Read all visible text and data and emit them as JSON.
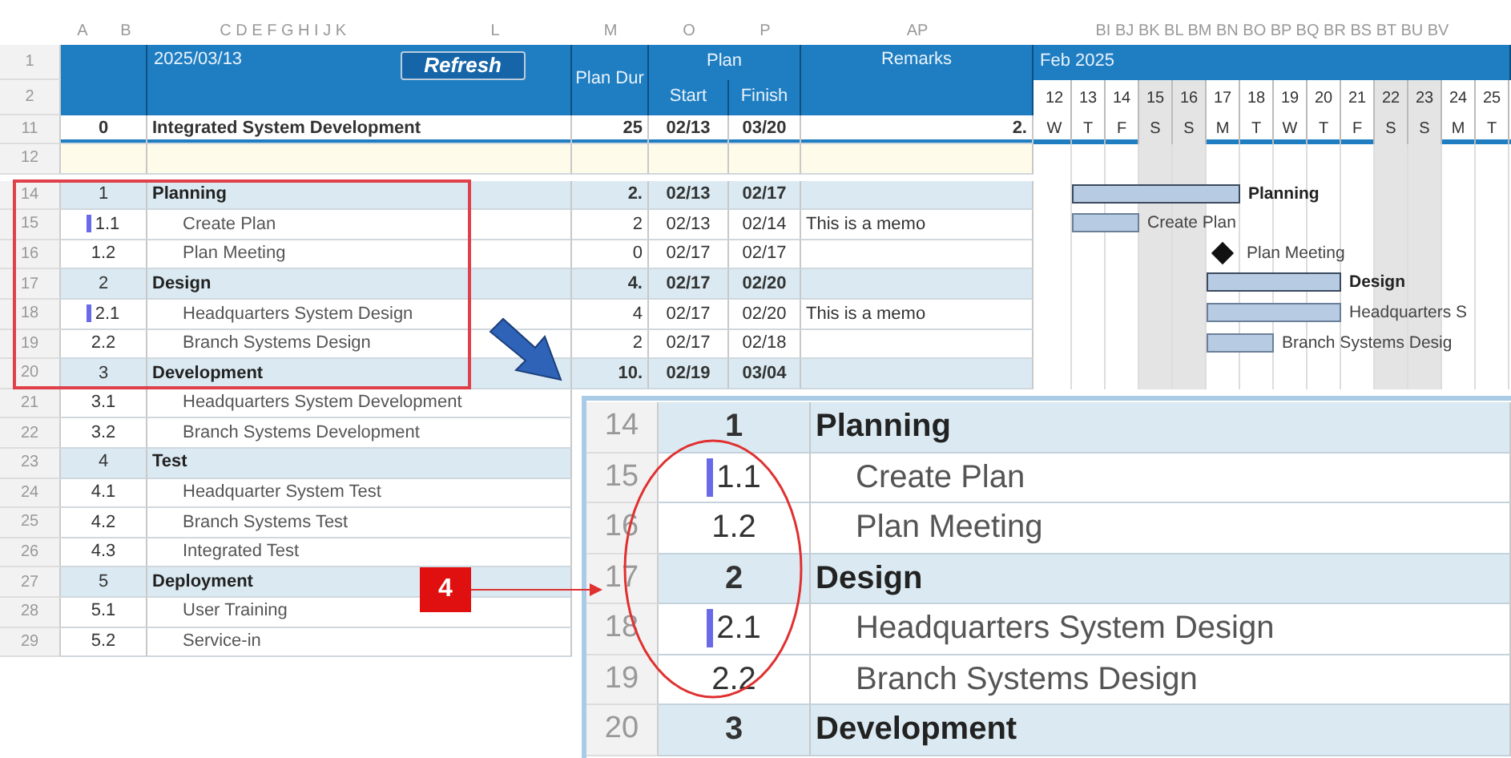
{
  "column_letters": [
    [
      "A",
      "B"
    ],
    [
      "C D E F G H I J K",
      "L"
    ],
    [
      "M"
    ],
    [
      "O"
    ],
    [
      "P"
    ],
    [
      "AP"
    ],
    [
      "BI BJ BK BL BM BN BO BP BQ BR BS BT BU BV"
    ]
  ],
  "header": {
    "rows": [
      "1",
      "2"
    ],
    "date": "2025/03/13",
    "refresh": "Refresh",
    "plan_dur": "Plan Dur",
    "plan": "Plan",
    "start": "Start",
    "finish": "Finish",
    "remarks": "Remarks",
    "month": "Feb 2025"
  },
  "days": [
    {
      "day": "12",
      "weekday": "W",
      "weekend": false
    },
    {
      "day": "13",
      "weekday": "T",
      "weekend": false
    },
    {
      "day": "14",
      "weekday": "F",
      "weekend": false
    },
    {
      "day": "15",
      "weekday": "S",
      "weekend": true
    },
    {
      "day": "16",
      "weekday": "S",
      "weekend": true
    },
    {
      "day": "17",
      "weekday": "M",
      "weekend": false
    },
    {
      "day": "18",
      "weekday": "T",
      "weekend": false
    },
    {
      "day": "19",
      "weekday": "W",
      "weekend": false
    },
    {
      "day": "20",
      "weekday": "T",
      "weekend": false
    },
    {
      "day": "21",
      "weekday": "F",
      "weekend": false
    },
    {
      "day": "22",
      "weekday": "S",
      "weekend": true
    },
    {
      "day": "23",
      "weekday": "S",
      "weekend": true
    },
    {
      "day": "24",
      "weekday": "M",
      "weekend": false
    },
    {
      "day": "25",
      "weekday": "T",
      "weekend": false
    }
  ],
  "project": {
    "row": "11",
    "wbs": "0",
    "task": "Integrated System Development",
    "dur": "25",
    "start": "02/13",
    "finish": "03/20",
    "remarks": "2."
  },
  "blank_row": {
    "row": "12"
  },
  "rows": [
    {
      "row": "14",
      "wbs": "1",
      "kind": "summary",
      "marker": false,
      "task": "Planning",
      "dur": "2.",
      "start": "02/13",
      "finish": "02/17",
      "bar_label": "Planning"
    },
    {
      "row": "15",
      "wbs": "1.1",
      "kind": "task",
      "marker": true,
      "task": "Create Plan",
      "dur": "2",
      "start": "02/13",
      "finish": "02/14",
      "remarks": "This is a memo",
      "bar_label": "Create Plan"
    },
    {
      "row": "16",
      "wbs": "1.2",
      "kind": "milestone",
      "marker": false,
      "task": "Plan Meeting",
      "dur": "0",
      "start": "02/17",
      "finish": "02/17",
      "bar_label": "Plan Meeting"
    },
    {
      "row": "17",
      "wbs": "2",
      "kind": "summary",
      "marker": false,
      "task": "Design",
      "dur": "4.",
      "start": "02/17",
      "finish": "02/20",
      "bar_label": "Design"
    },
    {
      "row": "18",
      "wbs": "2.1",
      "kind": "task",
      "marker": true,
      "task": "Headquarters System Design",
      "dur": "4",
      "start": "02/17",
      "finish": "02/20",
      "remarks": "This is a memo",
      "bar_label": "Headquarters S"
    },
    {
      "row": "19",
      "wbs": "2.2",
      "kind": "task",
      "marker": false,
      "task": "Branch Systems Design",
      "dur": "2",
      "start": "02/17",
      "finish": "02/18",
      "bar_label": "Branch Systems Desig"
    },
    {
      "row": "20",
      "wbs": "3",
      "kind": "summary",
      "marker": false,
      "task": "Development",
      "dur": "10.",
      "start": "02/19",
      "finish": "03/04"
    },
    {
      "row": "21",
      "wbs": "3.1",
      "kind": "task",
      "marker": false,
      "task": "Headquarters System Development"
    },
    {
      "row": "22",
      "wbs": "3.2",
      "kind": "task",
      "marker": false,
      "task": "Branch Systems Development"
    },
    {
      "row": "23",
      "wbs": "4",
      "kind": "summary",
      "marker": false,
      "task": "Test"
    },
    {
      "row": "24",
      "wbs": "4.1",
      "kind": "task",
      "marker": false,
      "task": "Headquarter System Test"
    },
    {
      "row": "25",
      "wbs": "4.2",
      "kind": "task",
      "marker": false,
      "task": "Branch Systems Test"
    },
    {
      "row": "26",
      "wbs": "4.3",
      "kind": "task",
      "marker": false,
      "task": "Integrated Test"
    },
    {
      "row": "27",
      "wbs": "5",
      "kind": "summary",
      "marker": false,
      "task": "Deployment"
    },
    {
      "row": "28",
      "wbs": "5.1",
      "kind": "task",
      "marker": false,
      "task": "User Training"
    },
    {
      "row": "29",
      "wbs": "5.2",
      "kind": "task",
      "marker": false,
      "task": "Service-in"
    }
  ],
  "zoom_inset": {
    "rows": [
      {
        "row": "14",
        "wbs": "1",
        "kind": "summary",
        "marker": false,
        "task": "Planning"
      },
      {
        "row": "15",
        "wbs": "1.1",
        "kind": "task",
        "marker": true,
        "task": "Create Plan"
      },
      {
        "row": "16",
        "wbs": "1.2",
        "kind": "task",
        "marker": false,
        "task": "Plan Meeting"
      },
      {
        "row": "17",
        "wbs": "2",
        "kind": "summary",
        "marker": false,
        "task": "Design"
      },
      {
        "row": "18",
        "wbs": "2.1",
        "kind": "task",
        "marker": true,
        "task": "Headquarters System Design"
      },
      {
        "row": "19",
        "wbs": "2.2",
        "kind": "task",
        "marker": false,
        "task": "Branch Systems Design"
      },
      {
        "row": "20",
        "wbs": "3",
        "kind": "summary",
        "marker": false,
        "task": "Development"
      }
    ]
  },
  "callout": {
    "number": "4"
  }
}
